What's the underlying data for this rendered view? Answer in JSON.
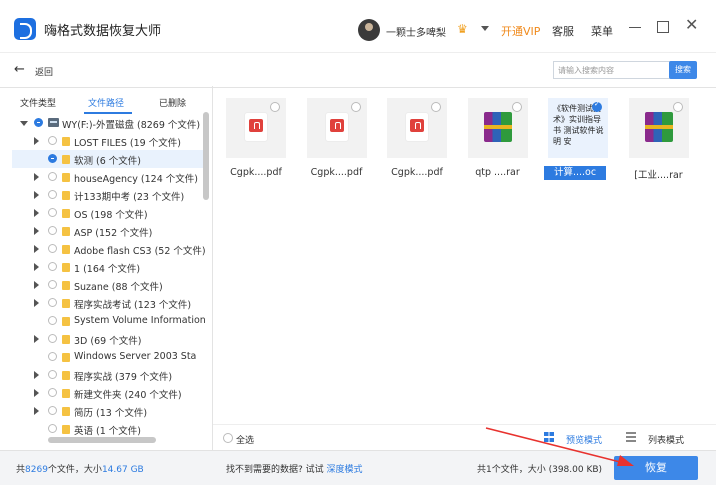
{
  "app": {
    "title": "嗨格式数据恢复大师"
  },
  "header": {
    "username": "一颗士多啤梨",
    "vip_link": "开通VIP",
    "service": "客服",
    "menu": "菜单"
  },
  "toolbar": {
    "back_label": "返回",
    "search_placeholder": "请输入搜索内容",
    "search_button": "搜索"
  },
  "tabs": [
    "文件类型",
    "文件路径",
    "已删除"
  ],
  "tree": [
    {
      "label": "WY(F:)-外置磁盘 (8269 个文件)",
      "depth": 0,
      "expander": "open",
      "check": "partial",
      "icon": "drive"
    },
    {
      "label": "LOST FILES (19 个文件)",
      "depth": 1,
      "expander": "closed",
      "check": "none",
      "icon": "folder"
    },
    {
      "label": "软测 (6 个文件)",
      "depth": 1,
      "expander": "none",
      "check": "partial",
      "icon": "folder",
      "selected": true
    },
    {
      "label": "houseAgency (124 个文件)",
      "depth": 1,
      "expander": "closed",
      "check": "none",
      "icon": "folder"
    },
    {
      "label": "计133期中考 (23 个文件)",
      "depth": 1,
      "expander": "closed",
      "check": "none",
      "icon": "folder"
    },
    {
      "label": "OS      (198 个文件)",
      "depth": 1,
      "expander": "closed",
      "check": "none",
      "icon": "folder"
    },
    {
      "label": "ASP     (152 个文件)",
      "depth": 1,
      "expander": "closed",
      "check": "none",
      "icon": "folder"
    },
    {
      "label": "Adobe flash CS3 (52 个文件)",
      "depth": 1,
      "expander": "closed",
      "check": "none",
      "icon": "folder"
    },
    {
      "label": "1       (164 个文件)",
      "depth": 1,
      "expander": "closed",
      "check": "none",
      "icon": "folder"
    },
    {
      "label": "Suzane (88 个文件)",
      "depth": 1,
      "expander": "closed",
      "check": "none",
      "icon": "folder"
    },
    {
      "label": "程序实战考试 (123 个文件)",
      "depth": 1,
      "expander": "closed",
      "check": "none",
      "icon": "folder"
    },
    {
      "label": "System Volume Information",
      "depth": 1,
      "expander": "none",
      "check": "none",
      "icon": "folder"
    },
    {
      "label": "3D      (69 个文件)",
      "depth": 1,
      "expander": "closed",
      "check": "none",
      "icon": "folder"
    },
    {
      "label": "Windows Server 2003 Sta",
      "depth": 1,
      "expander": "none",
      "check": "none",
      "icon": "folder"
    },
    {
      "label": "程序实战 (379 个文件)",
      "depth": 1,
      "expander": "closed",
      "check": "none",
      "icon": "folder"
    },
    {
      "label": "新建文件夹 (240 个文件)",
      "depth": 1,
      "expander": "closed",
      "check": "none",
      "icon": "folder"
    },
    {
      "label": "简历 (13 个文件)",
      "depth": 1,
      "expander": "closed",
      "check": "none",
      "icon": "folder"
    },
    {
      "label": "英语 (1 个文件)",
      "depth": 1,
      "expander": "none",
      "check": "none",
      "icon": "folder"
    }
  ],
  "files": [
    {
      "name": "Cgpk....pdf",
      "type": "pdf",
      "selected": false
    },
    {
      "name": "Cgpk....pdf",
      "type": "pdf",
      "selected": false
    },
    {
      "name": "Cgpk....pdf",
      "type": "pdf",
      "selected": false
    },
    {
      "name": "qtp ....rar",
      "type": "rar",
      "selected": false
    },
    {
      "name": "计算....oc",
      "type": "doc",
      "selected": true,
      "preview": "《软件测试技术》实训指导书 测试软件说明 安"
    },
    {
      "name": "[工业....rar",
      "type": "rar",
      "selected": false
    }
  ],
  "footer": {
    "select_all": "全选",
    "grid_view": "预览模式",
    "list_view": "列表模式"
  },
  "status": {
    "total_prefix": "共",
    "total_count": "8269",
    "total_mid": "个文件，大小",
    "total_size": "14.67 GB",
    "not_found": "找不到需要的数据? 试试",
    "deep_mode": "深度模式",
    "selected_summary": "共1个文件，大小  (398.00 KB)",
    "recover_button": "恢复"
  },
  "colors": {
    "accent": "#2d7be0",
    "vip": "#f08a1c",
    "annotation": "#e8322e"
  }
}
